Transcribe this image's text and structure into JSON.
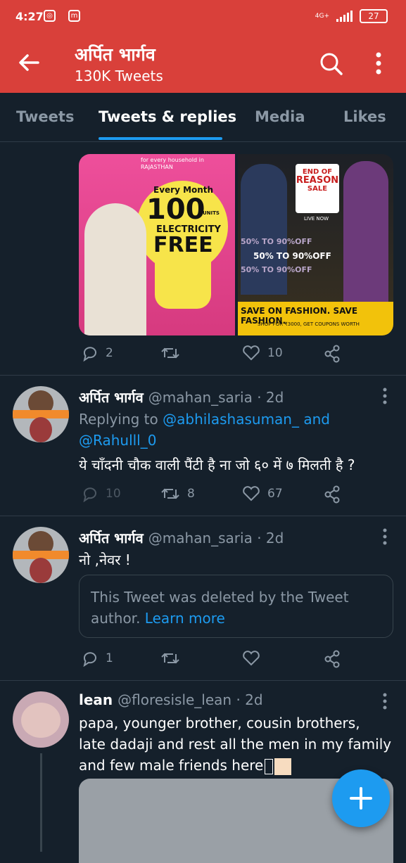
{
  "status": {
    "time": "4:27",
    "battery": "27",
    "net": "4G+"
  },
  "header": {
    "title": "अर्पित भार्गव",
    "subtitle": "130K Tweets"
  },
  "tabs": [
    {
      "label": "Tweets"
    },
    {
      "label": "Tweets & replies"
    },
    {
      "label": "Media"
    },
    {
      "label": "Likes"
    }
  ],
  "tweet0": {
    "img1": {
      "line1": "for every household in",
      "line2": "RAJASTHAN",
      "every": "Every Month",
      "num": "100",
      "units": "UNITS",
      "elec": "ELECTRICITY",
      "free": "FREE"
    },
    "img2": {
      "sale1": "END OF",
      "sale2": "REASON",
      "sale3": "SALE",
      "live": "LIVE NOW",
      "off1": "50% TO 90%OFF",
      "off2": "50% TO 90%OFF",
      "off3": "50% TO 90%OFF",
      "save": "SAVE ON FASHION. SAVE FASHION.",
      "shop": "SHOP FOR ₹3000, GET COUPONS WORTH"
    },
    "reply_count": "2",
    "like_count": "10"
  },
  "tweet1": {
    "name": "अर्पित भार्गव",
    "handle": "@mahan_saria · 2d",
    "replying_prefix": "Replying to",
    "replying_to1": "@abhilashasuman_ and",
    "replying_to2": "@Rahulll_0",
    "text": "ये चाँदनी चौक वाली पैंटी है ना जो ६० में ७ मिलती है ?",
    "reply_count": "10",
    "retweet_count": "8",
    "like_count": "67"
  },
  "tweet2": {
    "name": "अर्पित भार्गव",
    "handle": "@mahan_saria · 2d",
    "text": "नो ,नेवर !",
    "deleted": "This Tweet was deleted by the Tweet author.",
    "learn": "Learn more",
    "reply_count": "1"
  },
  "tweet3": {
    "name": "lean",
    "handle": "@floresisle_lean · 2d",
    "line1": "papa, younger brother, cousin brothers,",
    "line2": "late dadaji and rest all the men in my family",
    "line3": "and few male friends here"
  },
  "colors": {
    "header": "#d9403a",
    "bg": "#15202b",
    "accent": "#1d9bf0"
  }
}
